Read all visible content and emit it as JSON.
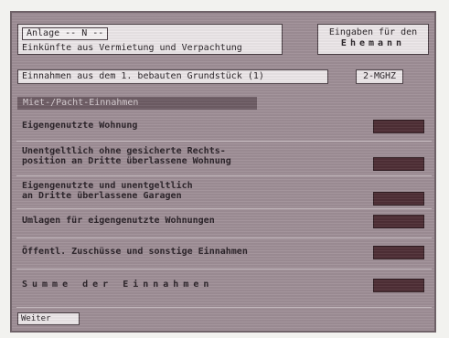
{
  "header": {
    "form_tag": "Anlage -- N --",
    "form_subtitle": "Einkünfte aus Vermietung und Verpachtung",
    "side_box_line1": "Eingaben für den",
    "side_box_line2": "Ehemann"
  },
  "property_row": {
    "label": "Einnahmen aus dem 1. bebauten Grundstück (1)",
    "button": "2-MGHZ"
  },
  "section_bar": {
    "label": "Miet-/Pacht-Einnahmen"
  },
  "items": [
    {
      "label": "Eigengenutzte Wohnung",
      "value": ""
    },
    {
      "label": "Unentgeltlich ohne gesicherte Rechts-\nposition an Dritte überlassene Wohnung",
      "value": ""
    },
    {
      "label": "Eigengenutzte und unentgeltlich\nan Dritte überlassene Garagen",
      "value": ""
    },
    {
      "label": "Umlagen für eigengenutzte Wohnungen",
      "value": ""
    },
    {
      "label": "Öffentl. Zuschüsse und sonstige Einnahmen",
      "value": ""
    },
    {
      "label": "Summe der Einnahmen",
      "value": ""
    }
  ],
  "footer": {
    "button": "Weiter"
  },
  "colors": {
    "screen_bg": "#9f8f97",
    "field_bg": "#4f2f36",
    "bar_bg": "#6e5d65"
  }
}
